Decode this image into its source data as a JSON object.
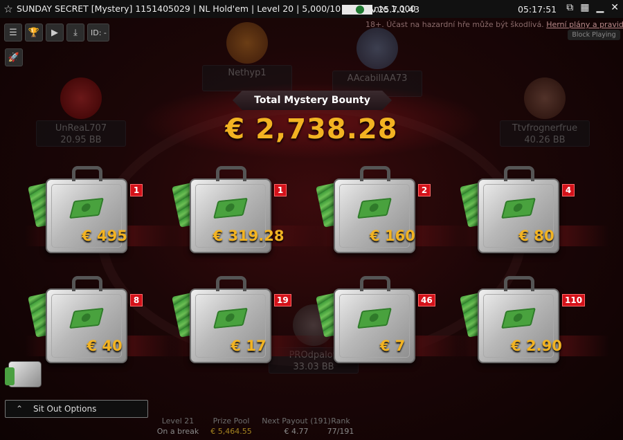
{
  "titlebar": {
    "title_left": "SUNDAY SECRET [Mystery] 1151405029 | NL Hold'em | Level 20 | 5,000/10",
    "title_right": "nte 1,000",
    "version": "v.25.7.1.43",
    "clock": "05:17:51"
  },
  "toolbar": {
    "id_label": "ID: -"
  },
  "notice": {
    "warning": "18+. Účast na hazardní hře může být škodlivá.",
    "link": "Herní plány a pravidla.",
    "block_playing": "Block Playing"
  },
  "players": [
    {
      "name": "Nethyp1",
      "stack": ""
    },
    {
      "name": "AAcabillAA73",
      "stack": ""
    },
    {
      "name": "UnReaL707",
      "stack": "20.95 BB"
    },
    {
      "name": "Ttvfrognerfrue",
      "stack": "40.26 BB"
    },
    {
      "name": "PROdpalov",
      "stack": "33.03 BB"
    }
  ],
  "bounty": {
    "header": "Total Mystery Bounty",
    "total": "€ 2,738.28",
    "cases": [
      {
        "amount": "€ 495",
        "count": "1"
      },
      {
        "amount": "€ 319.28",
        "count": "1"
      },
      {
        "amount": "€ 160",
        "count": "2"
      },
      {
        "amount": "€ 80",
        "count": "4"
      },
      {
        "amount": "€ 40",
        "count": "8"
      },
      {
        "amount": "€ 17",
        "count": "19"
      },
      {
        "amount": "€ 7",
        "count": "46"
      },
      {
        "amount": "€ 2.90",
        "count": "110"
      }
    ]
  },
  "sit_out": {
    "label": "Sit Out Options"
  },
  "stats": {
    "level_label": "Level 21",
    "level_value": "On a break",
    "prize_label": "Prize Pool",
    "prize_value": "€ 5,464.55",
    "payout_label": "Next Payout (191)",
    "payout_value": "€ 4.77",
    "rank_label": "Rank",
    "rank_value": "77/191"
  }
}
